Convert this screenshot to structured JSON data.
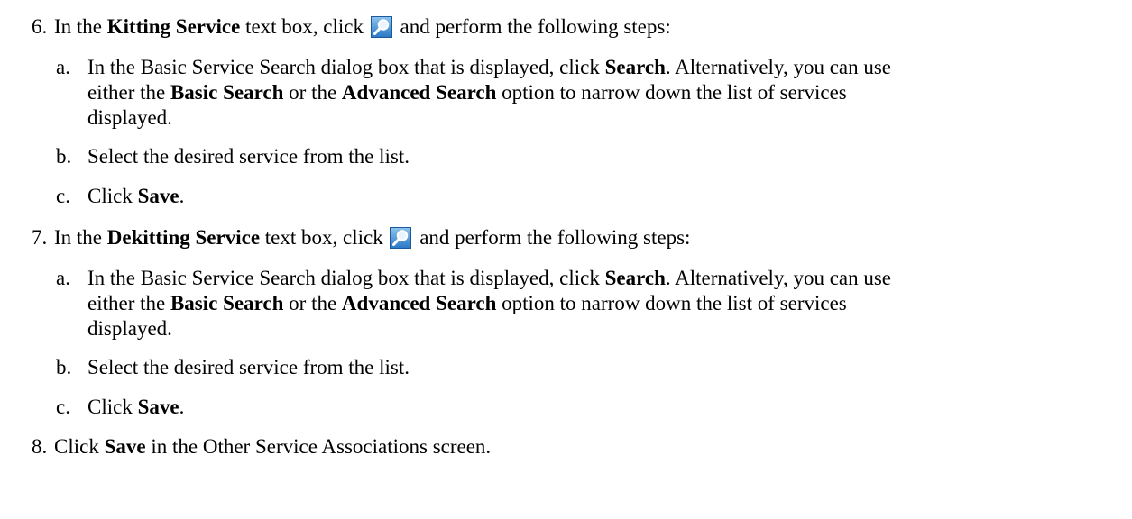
{
  "steps": [
    {
      "number": "6.",
      "intro": {
        "t1": "In the ",
        "b1": "Kitting Service",
        "t2": " text box, click ",
        "icon": "magnifier-search-icon",
        "t3": " and perform the following steps:"
      },
      "substeps": [
        {
          "letter": "a.",
          "line1": {
            "t1": "In the Basic Service Search dialog box that is displayed, click ",
            "b1": "Search",
            "t2": ". Alternatively, you can use"
          },
          "line2": {
            "t1": "either the ",
            "b1": "Basic Search",
            "t2": " or the ",
            "b2": "Advanced Search",
            "t3": " option to narrow down the list of services"
          },
          "line3": "displayed."
        },
        {
          "letter": "b.",
          "text": "Select the desired service from the list."
        },
        {
          "letter": "c.",
          "t1": "Click ",
          "b1": "Save",
          "t2": "."
        }
      ]
    },
    {
      "number": "7.",
      "intro": {
        "t1": "In the ",
        "b1": "Dekitting Service",
        "t2": " text box, click ",
        "icon": "magnifier-search-icon",
        "t3": " and perform the following steps:"
      },
      "substeps": [
        {
          "letter": "a.",
          "line1": {
            "t1": "In the Basic Service Search dialog box that is displayed, click ",
            "b1": "Search",
            "t2": ". Alternatively, you can use"
          },
          "line2": {
            "t1": "either the ",
            "b1": "Basic Search",
            "t2": " or the ",
            "b2": "Advanced Search",
            "t3": " option to narrow down the list of services"
          },
          "line3": "displayed."
        },
        {
          "letter": "b.",
          "text": "Select the desired service from the list."
        },
        {
          "letter": "c.",
          "t1": "Click ",
          "b1": "Save",
          "t2": "."
        }
      ]
    },
    {
      "number": "8.",
      "t1": "Click ",
      "b1": "Save",
      "t2": " in the Other Service Associations screen."
    }
  ],
  "colors": {
    "icon_bg_top": "#8ec4ec",
    "icon_bg_bottom": "#2a78c6",
    "icon_border": "#1a5a9c"
  }
}
